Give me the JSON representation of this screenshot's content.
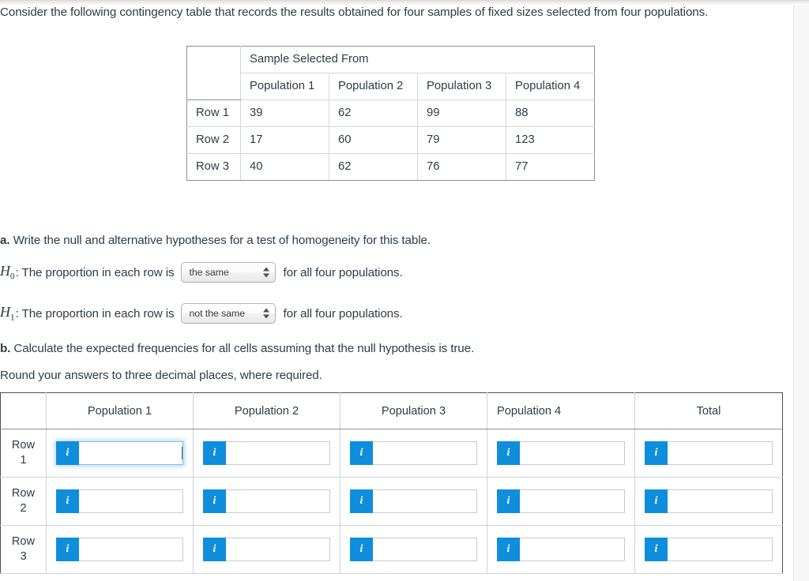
{
  "intro": {
    "text": "Consider the following contingency table that records the results obtained for four samples of fixed sizes selected from four populations."
  },
  "contingency_table": {
    "group_header": "Sample Selected From",
    "column_headers": [
      "Population 1",
      "Population 2",
      "Population 3",
      "Population 4"
    ],
    "rows": [
      {
        "label": "Row 1",
        "values": [
          "39",
          "62",
          "99",
          "88"
        ]
      },
      {
        "label": "Row 2",
        "values": [
          "17",
          "60",
          "79",
          "123"
        ]
      },
      {
        "label": "Row 3",
        "values": [
          "40",
          "62",
          "76",
          "77"
        ]
      }
    ]
  },
  "part_a": {
    "marker": "a.",
    "prompt": "Write the null and alternative hypotheses for a test of homogeneity for this table.",
    "null_hypothesis": {
      "symbol": "H",
      "subscript": "0",
      "lead": ": The proportion in each row is",
      "selected": "the same",
      "options": [
        "the same",
        "not the same"
      ],
      "tail": "for all four populations."
    },
    "alternative_hypothesis": {
      "symbol": "H",
      "subscript": "1",
      "lead": ": The proportion in each row is",
      "selected": "not the same",
      "options": [
        "the same",
        "not the same"
      ],
      "tail": "for all four populations."
    }
  },
  "part_b": {
    "marker": "b.",
    "prompt": "Calculate the expected frequencies for all cells assuming that the null hypothesis is true.",
    "rounding_note": "Round your answers to three decimal places, where required."
  },
  "answer_table": {
    "corner_header": "",
    "column_headers": [
      "Population 1",
      "Population 2",
      "Population 3",
      "Population 4",
      "Total"
    ],
    "rows": [
      {
        "label": "Row\n1",
        "label_line1": "Row",
        "label_line2": "1",
        "values": [
          "",
          "",
          "",
          "",
          ""
        ]
      },
      {
        "label": "Row\n2",
        "label_line1": "Row",
        "label_line2": "2",
        "values": [
          "",
          "",
          "",
          "",
          ""
        ]
      },
      {
        "label": "Row\n3",
        "label_line1": "Row",
        "label_line2": "3",
        "values": [
          "",
          "",
          "",
          "",
          ""
        ]
      }
    ],
    "input_placeholder": "",
    "info_icon_glyph": "i",
    "focused_cell": {
      "row": 0,
      "col": 0
    }
  },
  "colors": {
    "text": "#2f3c46",
    "info_badge_blue": "#0f8edb",
    "focus_ring_blue": "#7ec0e8",
    "table_border": "#cfd2d5",
    "table_outer_border": "#4a4f54",
    "gutter": "#f7f7f7"
  }
}
